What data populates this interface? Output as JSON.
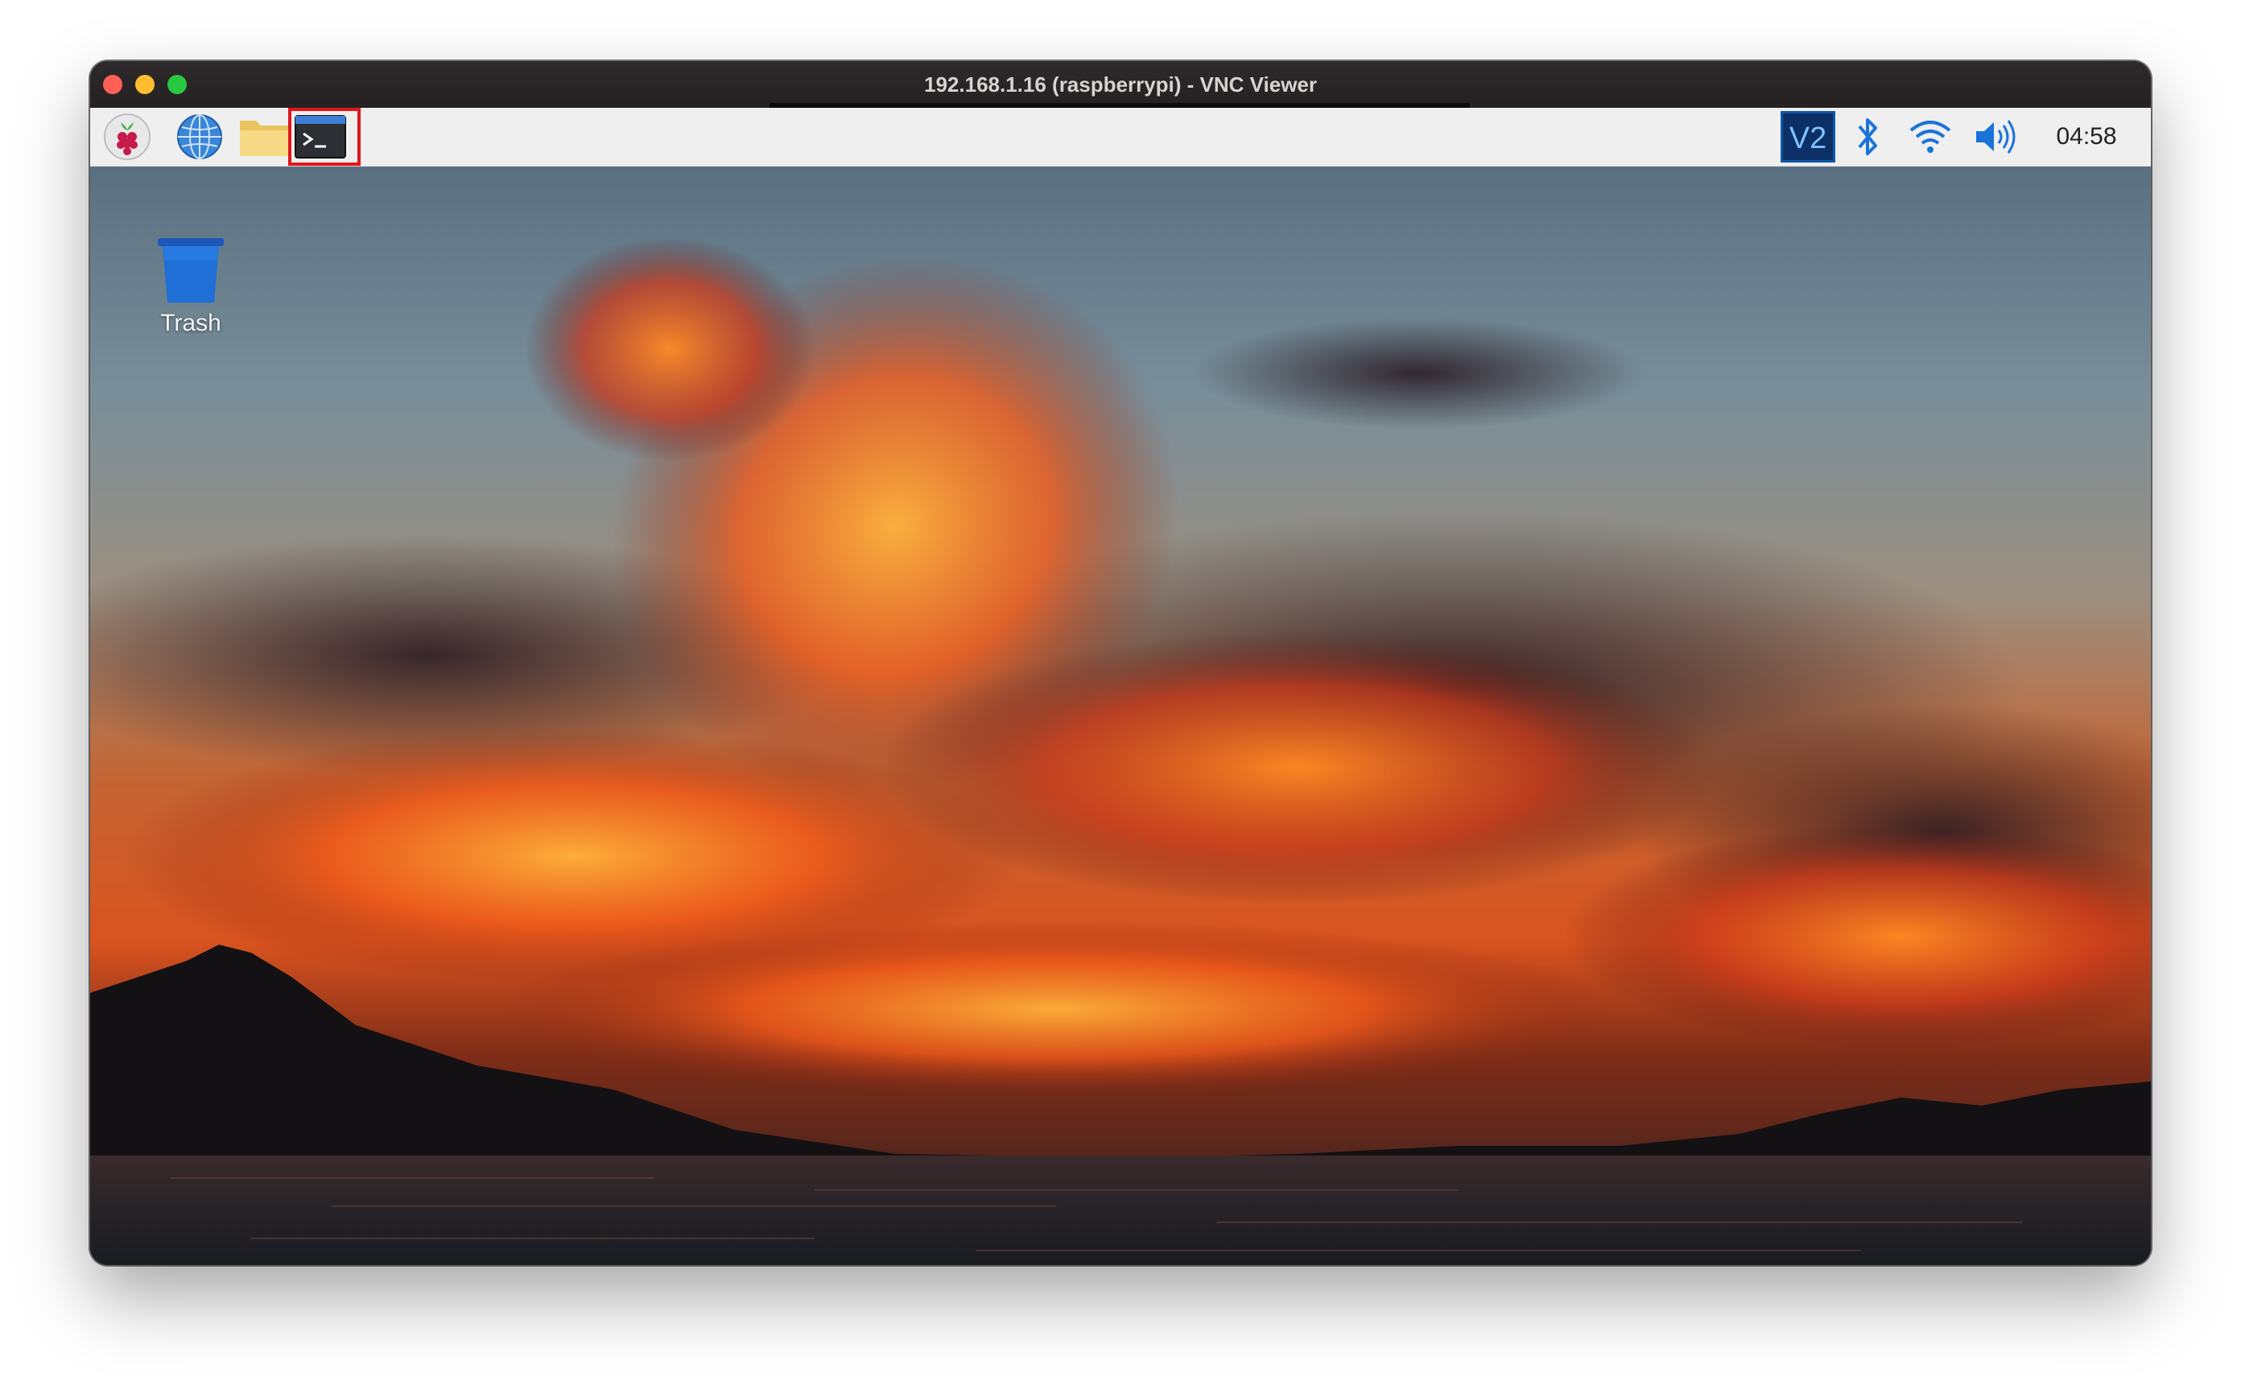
{
  "window": {
    "title": "192.168.1.16 (raspberrypi) - VNC Viewer"
  },
  "panel": {
    "launchers": [
      {
        "name": "raspberry-menu",
        "icon": "raspberry-pi-icon"
      },
      {
        "name": "web-browser",
        "icon": "globe-icon"
      },
      {
        "name": "file-manager",
        "icon": "folder-icon"
      },
      {
        "name": "terminal",
        "icon": "terminal-icon",
        "highlighted": true,
        "highlight_color": "#e0161b"
      }
    ],
    "tray": {
      "vnc_label": "V2",
      "clock": "04:58"
    }
  },
  "desktop": {
    "trash_label": "Trash"
  },
  "colors": {
    "titlebar": "#2b2728",
    "panel": "#efefef",
    "accent_blue": "#1a73d9",
    "highlight": "#e0161b"
  }
}
